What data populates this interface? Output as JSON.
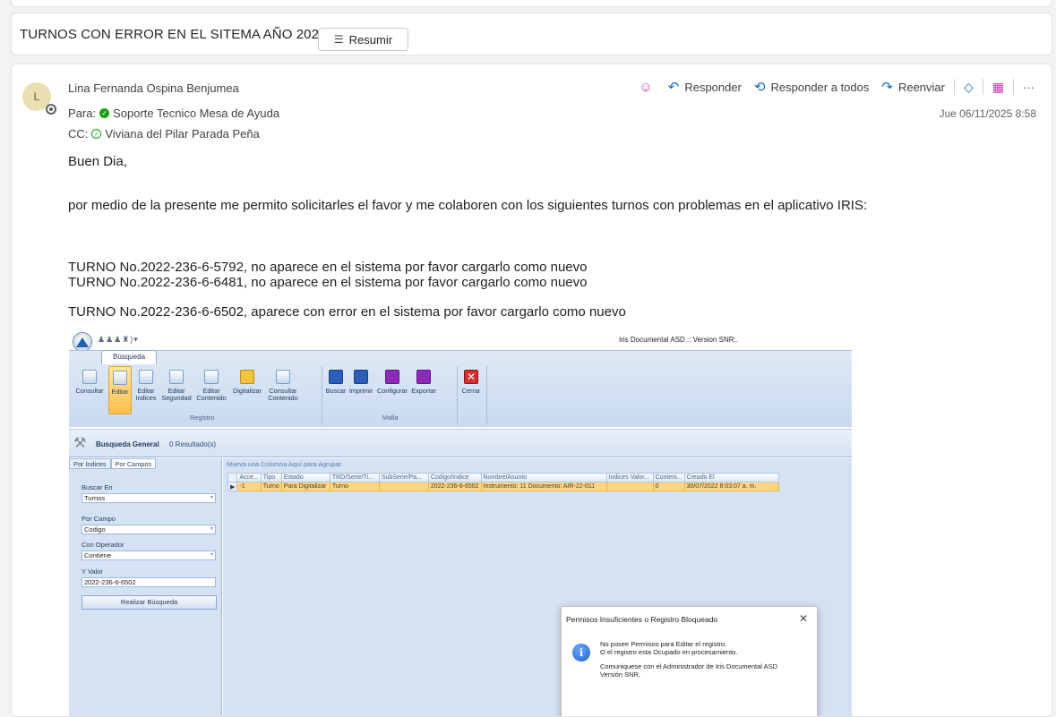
{
  "subject": "TURNOS CON ERROR EN EL SITEMA AÑO 2022",
  "summarize_label": "Resumir",
  "sender": {
    "initial": "L",
    "name": "Lina Fernanda Ospina Benjumea"
  },
  "to": {
    "label": "Para:",
    "name": "Soporte Tecnico Mesa de Ayuda"
  },
  "cc": {
    "label": "CC:",
    "name": "Viviana del Pilar Parada Peña"
  },
  "actions": {
    "reply": "Responder",
    "reply_all": "Responder a todos",
    "forward": "Reenviar",
    "more": "···"
  },
  "date": "Jue 06/11/2025 8:58",
  "body": {
    "greeting": "Buen Dia,",
    "intro": "por medio de la presente me permito solicitarles el favor y me colaboren con los siguientes turnos con problemas en el aplicativo IRIS:",
    "line1": "TURNO No.2022-236-6-5792, no aparece en el sistema por favor cargarlo como nuevo",
    "line2": "TURNO No.2022-236-6-6481, no aparece en el sistema por favor cargarlo como nuevo",
    "line3": "TURNO No.2022-236-6-6502, aparece con error en el sistema por favor cargarlo como nuevo"
  },
  "iris": {
    "window_title": "Iris Documental ASD :: Version SNR:.",
    "tab": "Búsqueda",
    "buttons": [
      {
        "l1": "Consultar",
        "l2": ""
      },
      {
        "l1": "Editar",
        "l2": ""
      },
      {
        "l1": "Editar",
        "l2": "Indices"
      },
      {
        "l1": "Editar",
        "l2": "Seguridad"
      },
      {
        "l1": "Editar",
        "l2": "Contenido"
      },
      {
        "l1": "Digitalizar",
        "l2": ""
      },
      {
        "l1": "Consultar",
        "l2": "Contenido"
      },
      {
        "l1": "Buscar",
        "l2": ""
      },
      {
        "l1": "Imprimir",
        "l2": ""
      },
      {
        "l1": "Configurar",
        "l2": ""
      },
      {
        "l1": "Exportar",
        "l2": ""
      },
      {
        "l1": "Cerrar",
        "l2": ""
      }
    ],
    "groups": {
      "registro": "Registro",
      "malla": "Malla"
    },
    "search_title": "Busqueda General",
    "result_count": "0 Resultado(s)",
    "left_tabs": [
      "Por Indices",
      "Por Campos"
    ],
    "buscar_en": {
      "label": "Buscar En",
      "value": "Turnos"
    },
    "por_campo": {
      "label": "Por Campo",
      "value": "Codigo"
    },
    "con_operador": {
      "label": "Con Operador",
      "value": "Contiene"
    },
    "y_valor": {
      "label": "Y Valor",
      "value": "2022-236-6-6502"
    },
    "search_button": "Realizar Búsqueda",
    "group_hint": "Mueva una Columna Aquí para Agrupar",
    "columns": [
      "Acce...",
      "Tipo",
      "Estado",
      "TRD/Serie/Ti...",
      "SubSerie/Pa...",
      "Codigo/Indice",
      "Nombre/Asunto",
      "Indices Valor...",
      "Conteni...",
      "Creado El"
    ],
    "row": [
      "-1",
      "Turno",
      "Para Digitalizar",
      "Turno",
      "",
      "2022-236-6-6502",
      "Instrumento: 11 Documento: AIR-22-011",
      "",
      "0",
      "30/07/2022 8:03:07 a. m."
    ],
    "dialog": {
      "title": "Permisos Insuficientes o Registro Bloqueado",
      "line1": "No posee Permisos para Editar el registro.",
      "line2": "O el registro esta Ocupado en procesamiento.",
      "line3": "Comuniquese con el Administrador de Iris Documental  ASD",
      "line4": "Versión SNR,"
    }
  },
  "colors": {
    "accent": "#0f6cbd",
    "presence": "#13a10e",
    "selected_row": "#ffd780"
  }
}
